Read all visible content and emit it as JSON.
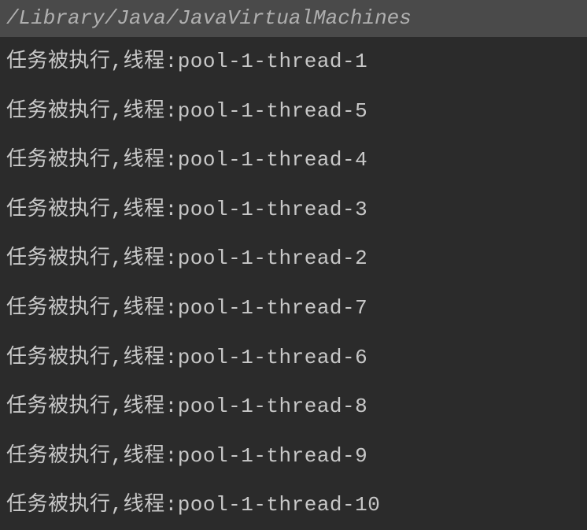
{
  "header": {
    "path": "/Library/Java/JavaVirtualMachines"
  },
  "output": {
    "lines": [
      "任务被执行,线程:pool-1-thread-1",
      "任务被执行,线程:pool-1-thread-5",
      "任务被执行,线程:pool-1-thread-4",
      "任务被执行,线程:pool-1-thread-3",
      "任务被执行,线程:pool-1-thread-2",
      "任务被执行,线程:pool-1-thread-7",
      "任务被执行,线程:pool-1-thread-6",
      "任务被执行,线程:pool-1-thread-8",
      "任务被执行,线程:pool-1-thread-9",
      "任务被执行,线程:pool-1-thread-10"
    ]
  }
}
